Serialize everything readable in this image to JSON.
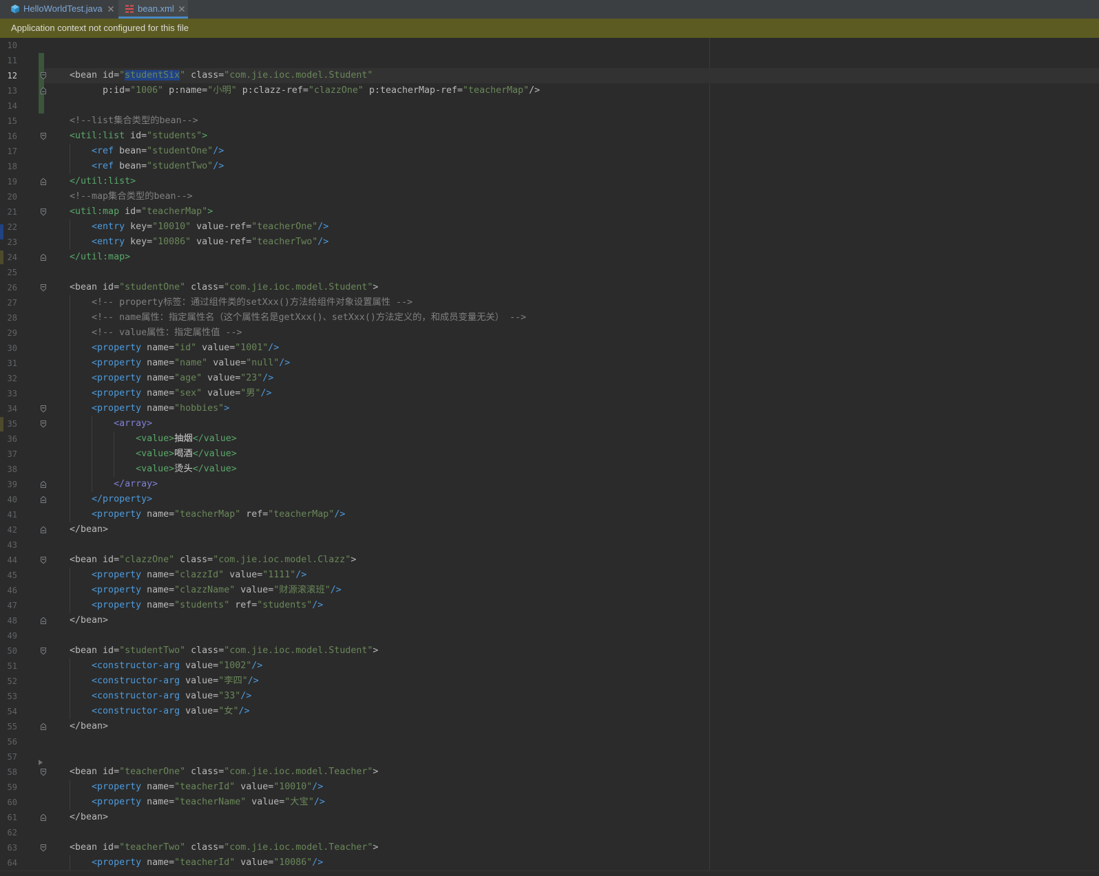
{
  "tabs": [
    {
      "label": "HelloWorldTest.java",
      "icon": "java-class-icon",
      "close_icon": "close-icon",
      "active": false
    },
    {
      "label": "bean.xml",
      "icon": "xml-file-icon",
      "close_icon": "close-icon",
      "active": true
    }
  ],
  "notification": {
    "text": "Application context not configured for this file"
  },
  "colors": {
    "notification_bg": "#5c5b22",
    "active_tab_accent": "#4a88c7",
    "selection_bg": "#214283",
    "caret_row_bg": "#323232",
    "vcs_changed": "#3b563b"
  },
  "editor": {
    "caret_line": 12,
    "changed_lines": [
      11,
      12,
      13,
      14
    ],
    "lines": [
      {
        "n": 10,
        "tokens": []
      },
      {
        "n": 11,
        "tokens": []
      },
      {
        "n": 12,
        "fold": "fold-start-icon",
        "tokens": [
          [
            "#bababa",
            "    <bean id="
          ],
          [
            "#6a8759",
            "\""
          ],
          [
            "#6a8759",
            "studentSix",
            true
          ],
          [
            "#6a8759",
            "\""
          ],
          [
            "#bababa",
            " class="
          ],
          [
            "#6a8759",
            "\"com.jie.ioc.model.Student\""
          ]
        ]
      },
      {
        "n": 13,
        "fold": "fold-end-icon",
        "tokens": [
          [
            "#bababa",
            "          p:id="
          ],
          [
            "#6a8759",
            "\"1006\""
          ],
          [
            "#bababa",
            " p:name="
          ],
          [
            "#6a8759",
            "\"小明\""
          ],
          [
            "#bababa",
            " p:clazz-ref="
          ],
          [
            "#6a8759",
            "\"clazzOne\""
          ],
          [
            "#bababa",
            " p:teacherMap-ref="
          ],
          [
            "#6a8759",
            "\"teacherMap\""
          ],
          [
            "#bababa",
            "/>"
          ]
        ]
      },
      {
        "n": 14,
        "tokens": []
      },
      {
        "n": 15,
        "tokens": [
          [
            "#808080",
            "    <!--list集合类型的bean-->"
          ]
        ]
      },
      {
        "n": 16,
        "fold": "fold-start-icon",
        "tokens": [
          [
            "#59a869",
            "    <util:list"
          ],
          [
            "#bababa",
            " id="
          ],
          [
            "#6a8759",
            "\"students\""
          ],
          [
            "#59a869",
            ">"
          ]
        ]
      },
      {
        "n": 17,
        "tokens": [
          [
            "#4d9bdd",
            "        <ref"
          ],
          [
            "#bababa",
            " bean="
          ],
          [
            "#6a8759",
            "\"studentOne\""
          ],
          [
            "#4d9bdd",
            "/>"
          ]
        ]
      },
      {
        "n": 18,
        "tokens": [
          [
            "#4d9bdd",
            "        <ref"
          ],
          [
            "#bababa",
            " bean="
          ],
          [
            "#6a8759",
            "\"studentTwo\""
          ],
          [
            "#4d9bdd",
            "/>"
          ]
        ]
      },
      {
        "n": 19,
        "fold": "fold-end-icon",
        "tokens": [
          [
            "#59a869",
            "    </util:list>"
          ]
        ]
      },
      {
        "n": 20,
        "tokens": [
          [
            "#808080",
            "    <!--map集合类型的bean-->"
          ]
        ]
      },
      {
        "n": 21,
        "fold": "fold-start-icon",
        "tokens": [
          [
            "#59a869",
            "    <util:map"
          ],
          [
            "#bababa",
            " id="
          ],
          [
            "#6a8759",
            "\"teacherMap\""
          ],
          [
            "#59a869",
            ">"
          ]
        ]
      },
      {
        "n": 22,
        "tokens": [
          [
            "#4d9bdd",
            "        <entry"
          ],
          [
            "#bababa",
            " key="
          ],
          [
            "#6a8759",
            "\"10010\""
          ],
          [
            "#bababa",
            " value-ref="
          ],
          [
            "#6a8759",
            "\"teacherOne\""
          ],
          [
            "#4d9bdd",
            "/>"
          ]
        ]
      },
      {
        "n": 23,
        "tokens": [
          [
            "#4d9bdd",
            "        <entry"
          ],
          [
            "#bababa",
            " key="
          ],
          [
            "#6a8759",
            "\"10086\""
          ],
          [
            "#bababa",
            " value-ref="
          ],
          [
            "#6a8759",
            "\"teacherTwo\""
          ],
          [
            "#4d9bdd",
            "/>"
          ]
        ]
      },
      {
        "n": 24,
        "fold": "fold-end-icon",
        "tokens": [
          [
            "#59a869",
            "    </util:map>"
          ]
        ]
      },
      {
        "n": 25,
        "tokens": []
      },
      {
        "n": 26,
        "fold": "fold-start-icon",
        "tokens": [
          [
            "#bababa",
            "    <bean id="
          ],
          [
            "#6a8759",
            "\"studentOne\""
          ],
          [
            "#bababa",
            " class="
          ],
          [
            "#6a8759",
            "\"com.jie.ioc.model.Student\""
          ],
          [
            "#bababa",
            ">"
          ]
        ]
      },
      {
        "n": 27,
        "tokens": [
          [
            "#808080",
            "        <!-- property标签：通过组件类的setXxx()方法给组件对象设置属性 -->"
          ]
        ]
      },
      {
        "n": 28,
        "tokens": [
          [
            "#808080",
            "        <!-- name属性：指定属性名（这个属性名是getXxx()、setXxx()方法定义的，和成员变量无关） -->"
          ]
        ]
      },
      {
        "n": 29,
        "tokens": [
          [
            "#808080",
            "        <!-- value属性：指定属性值 -->"
          ]
        ]
      },
      {
        "n": 30,
        "tokens": [
          [
            "#4d9bdd",
            "        <property"
          ],
          [
            "#bababa",
            " name="
          ],
          [
            "#6a8759",
            "\"id\""
          ],
          [
            "#bababa",
            " value="
          ],
          [
            "#6a8759",
            "\"1001\""
          ],
          [
            "#4d9bdd",
            "/>"
          ]
        ]
      },
      {
        "n": 31,
        "tokens": [
          [
            "#4d9bdd",
            "        <property"
          ],
          [
            "#bababa",
            " name="
          ],
          [
            "#6a8759",
            "\"name\""
          ],
          [
            "#bababa",
            " value="
          ],
          [
            "#6a8759",
            "\"null\""
          ],
          [
            "#4d9bdd",
            "/>"
          ]
        ]
      },
      {
        "n": 32,
        "tokens": [
          [
            "#4d9bdd",
            "        <property"
          ],
          [
            "#bababa",
            " name="
          ],
          [
            "#6a8759",
            "\"age\""
          ],
          [
            "#bababa",
            " value="
          ],
          [
            "#6a8759",
            "\"23\""
          ],
          [
            "#4d9bdd",
            "/>"
          ]
        ]
      },
      {
        "n": 33,
        "tokens": [
          [
            "#4d9bdd",
            "        <property"
          ],
          [
            "#bababa",
            " name="
          ],
          [
            "#6a8759",
            "\"sex\""
          ],
          [
            "#bababa",
            " value="
          ],
          [
            "#6a8759",
            "\"男\""
          ],
          [
            "#4d9bdd",
            "/>"
          ]
        ]
      },
      {
        "n": 34,
        "fold": "fold-start-icon",
        "tokens": [
          [
            "#4d9bdd",
            "        <property"
          ],
          [
            "#bababa",
            " name="
          ],
          [
            "#6a8759",
            "\"hobbies\""
          ],
          [
            "#4d9bdd",
            ">"
          ]
        ]
      },
      {
        "n": 35,
        "fold": "fold-start-icon",
        "tokens": [
          [
            "#8080d8",
            "            <array>"
          ]
        ]
      },
      {
        "n": 36,
        "tokens": [
          [
            "#59a869",
            "                <value>"
          ],
          [
            "#d4d4d4",
            "抽烟"
          ],
          [
            "#59a869",
            "</value>"
          ]
        ]
      },
      {
        "n": 37,
        "tokens": [
          [
            "#59a869",
            "                <value>"
          ],
          [
            "#d4d4d4",
            "喝酒"
          ],
          [
            "#59a869",
            "</value>"
          ]
        ]
      },
      {
        "n": 38,
        "tokens": [
          [
            "#59a869",
            "                <value>"
          ],
          [
            "#d4d4d4",
            "烫头"
          ],
          [
            "#59a869",
            "</value>"
          ]
        ]
      },
      {
        "n": 39,
        "fold": "fold-end-icon",
        "tokens": [
          [
            "#8080d8",
            "            </array>"
          ]
        ]
      },
      {
        "n": 40,
        "fold": "fold-end-icon",
        "tokens": [
          [
            "#4d9bdd",
            "        </property>"
          ]
        ]
      },
      {
        "n": 41,
        "tokens": [
          [
            "#4d9bdd",
            "        <property"
          ],
          [
            "#bababa",
            " name="
          ],
          [
            "#6a8759",
            "\"teacherMap\""
          ],
          [
            "#bababa",
            " ref="
          ],
          [
            "#6a8759",
            "\"teacherMap\""
          ],
          [
            "#4d9bdd",
            "/>"
          ]
        ]
      },
      {
        "n": 42,
        "fold": "fold-end-icon",
        "tokens": [
          [
            "#bababa",
            "    </bean>"
          ]
        ]
      },
      {
        "n": 43,
        "tokens": []
      },
      {
        "n": 44,
        "fold": "fold-start-icon",
        "tokens": [
          [
            "#bababa",
            "    <bean id="
          ],
          [
            "#6a8759",
            "\"clazzOne\""
          ],
          [
            "#bababa",
            " class="
          ],
          [
            "#6a8759",
            "\"com.jie.ioc.model.Clazz\""
          ],
          [
            "#bababa",
            ">"
          ]
        ]
      },
      {
        "n": 45,
        "tokens": [
          [
            "#4d9bdd",
            "        <property"
          ],
          [
            "#bababa",
            " name="
          ],
          [
            "#6a8759",
            "\"clazzId\""
          ],
          [
            "#bababa",
            " value="
          ],
          [
            "#6a8759",
            "\"1111\""
          ],
          [
            "#4d9bdd",
            "/>"
          ]
        ]
      },
      {
        "n": 46,
        "tokens": [
          [
            "#4d9bdd",
            "        <property"
          ],
          [
            "#bababa",
            " name="
          ],
          [
            "#6a8759",
            "\"clazzName\""
          ],
          [
            "#bababa",
            " value="
          ],
          [
            "#6a8759",
            "\"财源滚滚班\""
          ],
          [
            "#4d9bdd",
            "/>"
          ]
        ]
      },
      {
        "n": 47,
        "tokens": [
          [
            "#4d9bdd",
            "        <property"
          ],
          [
            "#bababa",
            " name="
          ],
          [
            "#6a8759",
            "\"students\""
          ],
          [
            "#bababa",
            " ref="
          ],
          [
            "#6a8759",
            "\"students\""
          ],
          [
            "#4d9bdd",
            "/>"
          ]
        ]
      },
      {
        "n": 48,
        "fold": "fold-end-icon",
        "tokens": [
          [
            "#bababa",
            "    </bean>"
          ]
        ]
      },
      {
        "n": 49,
        "tokens": []
      },
      {
        "n": 50,
        "fold": "fold-start-icon",
        "tokens": [
          [
            "#bababa",
            "    <bean id="
          ],
          [
            "#6a8759",
            "\"studentTwo\""
          ],
          [
            "#bababa",
            " class="
          ],
          [
            "#6a8759",
            "\"com.jie.ioc.model.Student\""
          ],
          [
            "#bababa",
            ">"
          ]
        ]
      },
      {
        "n": 51,
        "tokens": [
          [
            "#4d9bdd",
            "        <constructor-arg"
          ],
          [
            "#bababa",
            " value="
          ],
          [
            "#6a8759",
            "\"1002\""
          ],
          [
            "#4d9bdd",
            "/>"
          ]
        ]
      },
      {
        "n": 52,
        "tokens": [
          [
            "#4d9bdd",
            "        <constructor-arg"
          ],
          [
            "#bababa",
            " value="
          ],
          [
            "#6a8759",
            "\"李四\""
          ],
          [
            "#4d9bdd",
            "/>"
          ]
        ]
      },
      {
        "n": 53,
        "tokens": [
          [
            "#4d9bdd",
            "        <constructor-arg"
          ],
          [
            "#bababa",
            " value="
          ],
          [
            "#6a8759",
            "\"33\""
          ],
          [
            "#4d9bdd",
            "/>"
          ]
        ]
      },
      {
        "n": 54,
        "tokens": [
          [
            "#4d9bdd",
            "        <constructor-arg"
          ],
          [
            "#bababa",
            " value="
          ],
          [
            "#6a8759",
            "\"女\""
          ],
          [
            "#4d9bdd",
            "/>"
          ]
        ]
      },
      {
        "n": 55,
        "fold": "fold-end-icon",
        "tokens": [
          [
            "#bababa",
            "    </bean>"
          ]
        ]
      },
      {
        "n": 56,
        "tokens": []
      },
      {
        "n": 57,
        "marker": "arrow-marker-icon",
        "tokens": []
      },
      {
        "n": 58,
        "fold": "fold-start-icon",
        "tokens": [
          [
            "#bababa",
            "    <bean id="
          ],
          [
            "#6a8759",
            "\"teacherOne\""
          ],
          [
            "#bababa",
            " class="
          ],
          [
            "#6a8759",
            "\"com.jie.ioc.model.Teacher\""
          ],
          [
            "#bababa",
            ">"
          ]
        ]
      },
      {
        "n": 59,
        "tokens": [
          [
            "#4d9bdd",
            "        <property"
          ],
          [
            "#bababa",
            " name="
          ],
          [
            "#6a8759",
            "\"teacherId\""
          ],
          [
            "#bababa",
            " value="
          ],
          [
            "#6a8759",
            "\"10010\""
          ],
          [
            "#4d9bdd",
            "/>"
          ]
        ]
      },
      {
        "n": 60,
        "tokens": [
          [
            "#4d9bdd",
            "        <property"
          ],
          [
            "#bababa",
            " name="
          ],
          [
            "#6a8759",
            "\"teacherName\""
          ],
          [
            "#bababa",
            " value="
          ],
          [
            "#6a8759",
            "\"大宝\""
          ],
          [
            "#4d9bdd",
            "/>"
          ]
        ]
      },
      {
        "n": 61,
        "fold": "fold-end-icon",
        "tokens": [
          [
            "#bababa",
            "    </bean>"
          ]
        ]
      },
      {
        "n": 62,
        "tokens": []
      },
      {
        "n": 63,
        "fold": "fold-start-icon",
        "tokens": [
          [
            "#bababa",
            "    <bean id="
          ],
          [
            "#6a8759",
            "\"teacherTwo\""
          ],
          [
            "#bababa",
            " class="
          ],
          [
            "#6a8759",
            "\"com.jie.ioc.model.Teacher\""
          ],
          [
            "#bababa",
            ">"
          ]
        ]
      },
      {
        "n": 64,
        "tokens": [
          [
            "#4d9bdd",
            "        <property"
          ],
          [
            "#bababa",
            " name="
          ],
          [
            "#6a8759",
            "\"teacherId\""
          ],
          [
            "#bababa",
            " value="
          ],
          [
            "#6a8759",
            "\"10086\""
          ],
          [
            "#4d9bdd",
            "/>"
          ]
        ]
      }
    ]
  }
}
